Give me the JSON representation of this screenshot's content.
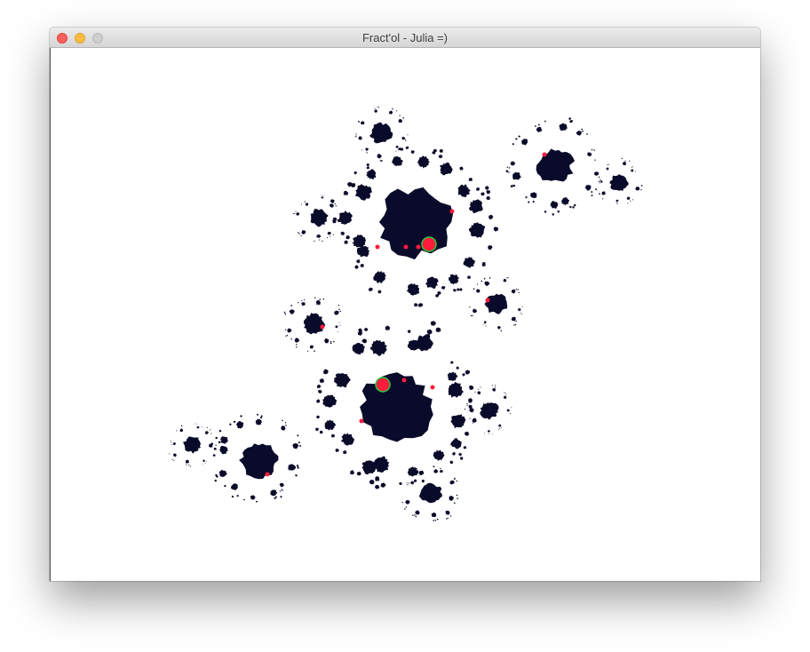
{
  "window": {
    "title": "Fract'ol - Julia =)",
    "buttons": {
      "close": "close",
      "minimize": "minimize",
      "zoom": "zoom"
    }
  },
  "canvas": {
    "fractal_type": "julia",
    "colors": {
      "background": "#ffffff",
      "set_fill": "#0a0a2a",
      "accent_red": "#ff1c3c",
      "accent_green": "#22cc44"
    }
  }
}
